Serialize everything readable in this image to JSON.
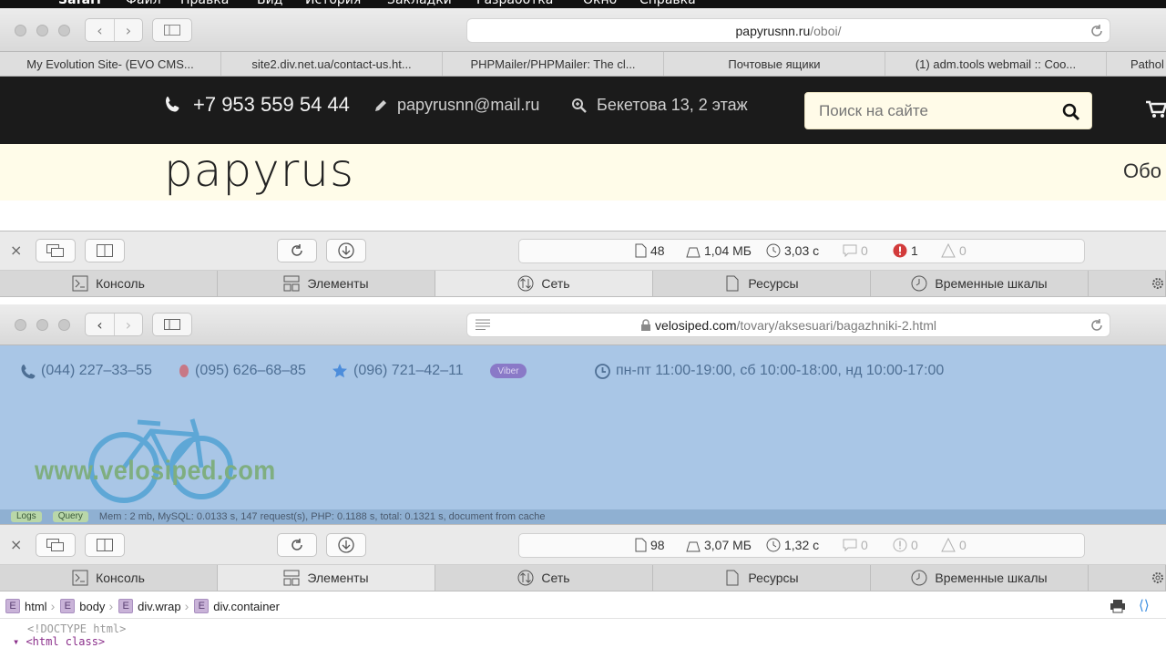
{
  "menubar": {
    "app": "Safari",
    "items": [
      "Файл",
      "Правка",
      "Вид",
      "История",
      "Закладки",
      "Разработка",
      "Окно",
      "Справка"
    ]
  },
  "window1": {
    "url_domain": "papyrusnn.ru",
    "url_path": "/oboi/"
  },
  "bookmarks": [
    "My Evolution Site- (EVO CMS...",
    "site2.div.net.ua/contact-us.ht...",
    "PHPMailer/PHPMailer: The cl...",
    "Почтовые ящики",
    "(1) adm.tools webmail :: Coo...",
    "Pathol"
  ],
  "papyrus": {
    "phone": "+7 953 559 54 44",
    "email": "papyrusnn@mail.ru",
    "address": "Бекетова 13, 2 этаж",
    "search_placeholder": "Поиск на сайте",
    "logo": "papyrus",
    "right_cut": "Обо"
  },
  "inspector1": {
    "resources": "48",
    "size": "1,04 МБ",
    "time": "3,03 с",
    "messages": "0",
    "errors": "1",
    "warnings": "0"
  },
  "tabs": [
    "Консоль",
    "Элементы",
    "Сеть",
    "Ресурсы",
    "Временные шкалы"
  ],
  "inspector1_active_tab": "Сеть",
  "window2": {
    "url_domain": "velosiped.com",
    "url_path": "/tovary/aksesuari/bagazhniki-2.html"
  },
  "velo": {
    "phone1": "(044) 227–33–55",
    "phone2": "(095) 626–68–85",
    "phone3": "(096) 721–42–11",
    "viber": "Viber",
    "hours": "пн-пт 11:00-19:00, сб 10:00-18:00, нд 10:00-17:00",
    "logo_text": "www.velosiped.com"
  },
  "debugbar": {
    "logs": "Logs",
    "query": "Query",
    "info": "Mem : 2 mb, MySQL: 0.0133 s, 147 request(s), PHP: 0.1188 s, total: 0.1321 s, document from cache"
  },
  "inspector2": {
    "resources": "98",
    "size": "3,07 МБ",
    "time": "1,32 с",
    "messages": "0",
    "errors": "0",
    "warnings": "0"
  },
  "inspector2_active_tab": "Элементы",
  "breadcrumb": [
    "html",
    "body",
    "div.wrap",
    "div.container"
  ],
  "breadcrumb_badge": "E",
  "dom": {
    "line1": "<!DOCTYPE html>",
    "line2": "<html class>"
  },
  "colors": {
    "site_top": "#1b1b1b",
    "site_band": "#fffce9",
    "velo_bg": "#a9c6e6",
    "error": "#d23b3b"
  }
}
